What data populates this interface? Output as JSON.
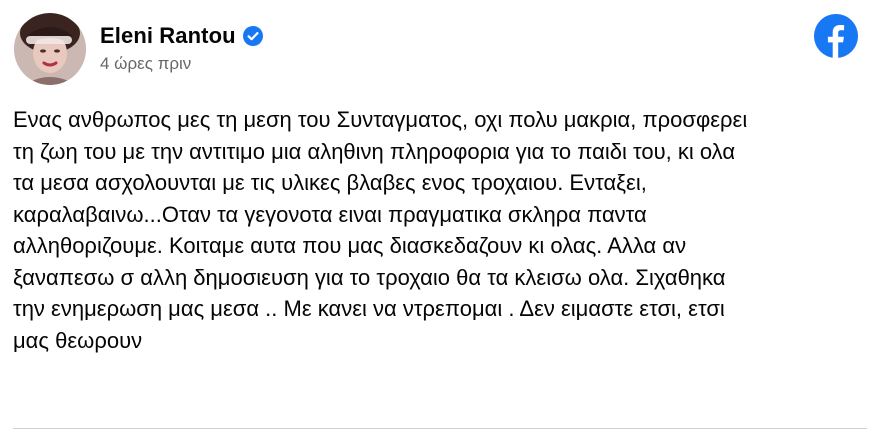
{
  "post": {
    "author_name": "Eleni Rantou",
    "timestamp": "4 ώρες πριν",
    "text": "Ενας ανθρωπος μες τη μεση του Συνταγματος, οχι πολυ μακρια, προσφερει\nτη ζωη του με την αντιτιμο μια αληθινη πληροφορια για το παιδι του, κι ολα\nτα μεσα ασχολουνται με τις υλικες βλαβες ενος τροχαιου. Ενταξει,\nκαραλαβαινω...Οταν τα γεγονοτα ειναι πραγματικα σκληρα παντα\nαλληθοριζουμε. Κοιταμε αυτα που μας διασκεδαζουν κι ολας. Αλλα αν\nξαναπεσω σ αλλη δημοσιευση για το τροχαιο θα τα κλεισω ολα. Σιχαθηκα\nτην ενημερωση μας μεσα .. Με κανει να ντρεπομαι . Δεν ειμαστε ετσι, ετσι\nμας θεωρουν"
  },
  "icons": {
    "verified": "verified-badge-icon",
    "platform": "facebook-logo-icon"
  },
  "colors": {
    "facebook_blue": "#1877f2",
    "verified_blue": "#1877f2",
    "secondary_text": "#65676b",
    "primary_text": "#050505",
    "divider": "#ced0d4"
  }
}
